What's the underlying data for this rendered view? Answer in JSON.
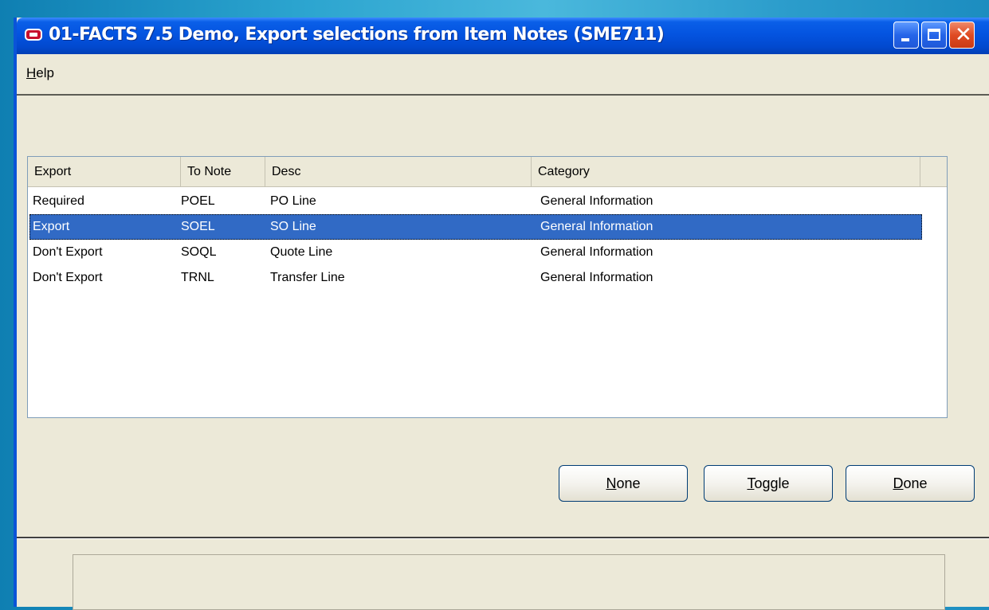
{
  "window": {
    "title": "01-FACTS 7.5 Demo, Export selections from Item Notes (SME711)"
  },
  "menu": {
    "items": [
      "Help"
    ]
  },
  "list": {
    "columns": [
      "Export",
      "To Note",
      "Desc",
      "Category"
    ],
    "rows": [
      {
        "export": "Required",
        "to_note": "POEL",
        "desc": "PO Line",
        "category": "General Information"
      },
      {
        "export": "Export",
        "to_note": "SOEL",
        "desc": "SO Line",
        "category": "General Information"
      },
      {
        "export": "Don't Export",
        "to_note": "SOQL",
        "desc": "Quote Line",
        "category": "General Information"
      },
      {
        "export": "Don't Export",
        "to_note": "TRNL",
        "desc": "Transfer Line",
        "category": "General Information"
      }
    ],
    "selected_row": 1
  },
  "buttons": {
    "none": "None",
    "toggle": "Toggle",
    "done": "Done"
  },
  "colors": {
    "title_bar": "#0454e0",
    "selection": "#316ac5",
    "window_bg": "#ece9d8",
    "close_button": "#e04b23"
  },
  "icons": [
    "app-icon",
    "minimize-icon",
    "maximize-icon",
    "close-icon"
  ]
}
